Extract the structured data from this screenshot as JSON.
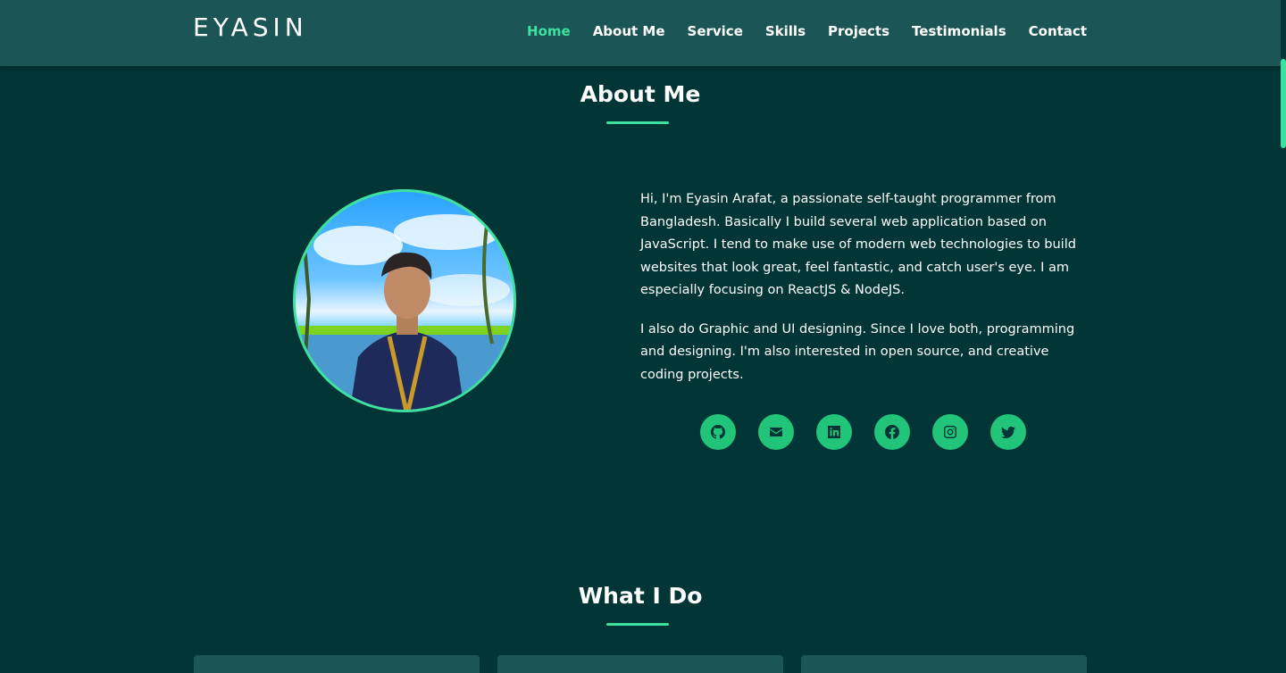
{
  "brand": "EYASIN",
  "nav": [
    {
      "label": "Home",
      "active": true
    },
    {
      "label": "About Me"
    },
    {
      "label": "Service"
    },
    {
      "label": "Skills"
    },
    {
      "label": "Projects"
    },
    {
      "label": "Testimonials"
    },
    {
      "label": "Contact"
    }
  ],
  "about": {
    "title": "About Me",
    "paragraph1": "Hi, I'm Eyasin Arafat, a passionate self-taught programmer from Bangladesh. Basically I build several web application based on JavaScript. I tend to make use of modern web technologies to build websites that look great, feel fantastic, and catch user's eye. I am especially focusing on ReactJS & NodeJS.",
    "paragraph2": "I also do Graphic and UI designing. Since I love both, programming and designing. I'm also interested in open source, and creative coding projects."
  },
  "socials": [
    "github-icon",
    "email-icon",
    "linkedin-icon",
    "facebook-icon",
    "instagram-icon",
    "twitter-icon"
  ],
  "services": {
    "title": "What I Do"
  },
  "colors": {
    "background": "#023535",
    "navbar": "#1c5555",
    "accent": "#3ee0a0",
    "social": "#22c47a"
  }
}
